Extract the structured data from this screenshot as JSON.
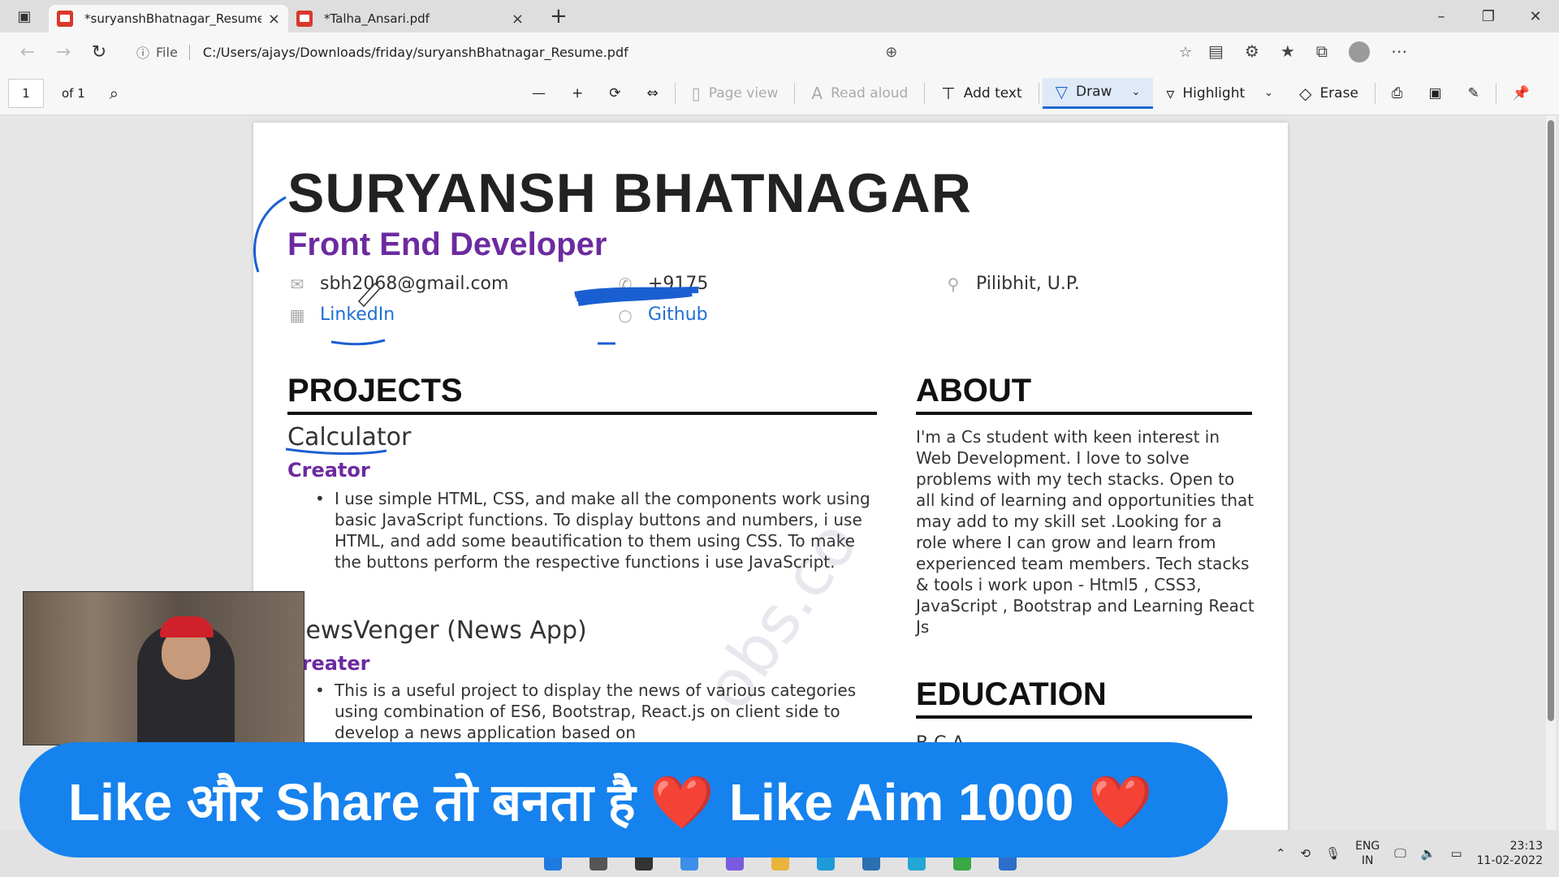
{
  "browser": {
    "tabs": [
      {
        "label": "*suryanshBhatnagar_Resume.pdf",
        "active": true
      },
      {
        "label": "*Talha_Ansari.pdf",
        "active": false
      }
    ],
    "new_tab": "+",
    "address": {
      "info_label": "File",
      "url": "C:/Users/ajays/Downloads/friday/suryanshBhatnagar_Resume.pdf"
    }
  },
  "pdf_toolbar": {
    "page_number": "1",
    "page_total": "of 1",
    "page_view": "Page view",
    "read_aloud": "Read aloud",
    "add_text": "Add text",
    "draw": "Draw",
    "highlight": "Highlight",
    "erase": "Erase"
  },
  "resume": {
    "name": "SURYANSH BHATNAGAR",
    "role": "Front End Developer",
    "email": "sbh2068@gmail.com",
    "phone": "+9175",
    "location": "Pilibhit, U.P.",
    "linkedin": "LinkedIn",
    "github": "Github",
    "projects_heading": "PROJECTS",
    "about_heading": "ABOUT",
    "education_heading": "EDUCATION",
    "education_sub": "B.C.A",
    "projects": [
      {
        "title": "Calculator",
        "role": "Creator",
        "bullet": "I use simple HTML, CSS, and make all the components work using basic JavaScript functions. To display buttons and numbers, i use HTML, and add some beautification to them using CSS. To make the buttons perform the respective functions i use JavaScript."
      },
      {
        "title": "NewsVenger (News App)",
        "role": "Creater",
        "bullet": "This is a useful project to display the news of various categories using combination of ES6, Bootstrap, React.js on client side to develop a news application based on"
      }
    ],
    "about": "I'm a Cs student with keen interest in Web Development. I love to solve problems with my tech stacks. Open to all kind of learning and opportunities that may add to my skill set .Looking for a role where I can grow and learn from experienced team members. Tech stacks & tools i work upon - Html5 , CSS3, JavaScript , Bootstrap and Learning React Js",
    "watermark": "obs.co"
  },
  "banner": {
    "text": "Like और Share तो बनता है ❤️ Like Aim 1000 ❤️"
  },
  "taskbar": {
    "lang_top": "ENG",
    "lang_bottom": "IN",
    "time": "23:13",
    "date": "11-02-2022"
  },
  "colors": {
    "accent_purple": "#6c2aa0",
    "link_blue": "#1f6fd1",
    "banner_blue": "#1582ee",
    "ink_blue": "#1a5fd1"
  }
}
